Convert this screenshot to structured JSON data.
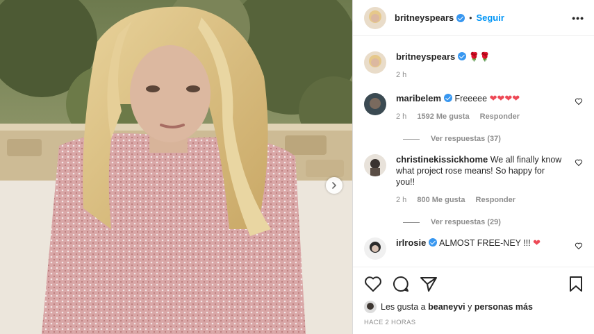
{
  "header": {
    "username": "britneyspears",
    "separator": "•",
    "follow_label": "Seguir",
    "more_label": "•••"
  },
  "caption": {
    "username": "britneyspears",
    "text": "🌹🌹",
    "time": "2 h"
  },
  "comments": [
    {
      "username": "maribelem",
      "verified": true,
      "text": "Freeeee",
      "hearts": "❤❤❤❤",
      "time": "2 h",
      "likes": "1592 Me gusta",
      "reply_label": "Responder",
      "view_replies": "Ver respuestas (37)"
    },
    {
      "username": "christinekissickhome",
      "verified": false,
      "text": "We all finally know what project rose means! So happy for you!!",
      "time": "2 h",
      "likes": "800 Me gusta",
      "reply_label": "Responder",
      "view_replies": "Ver respuestas (29)"
    },
    {
      "username": "irlrosie",
      "verified": true,
      "text": "ALMOST FREE-NEY !!!",
      "hearts": "❤"
    }
  ],
  "likes_line": {
    "prefix": "Les gusta a",
    "user": "beaneyvi",
    "suffix": "y",
    "others": "personas más"
  },
  "posted": "HACE 2 HORAS",
  "colors": {
    "accent": "#0095f6",
    "verified": "#3897f0",
    "heart": "#ed4956",
    "muted": "#8e8e8e"
  },
  "icons": [
    "heart-icon",
    "comment-icon",
    "share-icon",
    "bookmark-icon",
    "chevron-right-icon",
    "more-icon",
    "verified-icon"
  ]
}
